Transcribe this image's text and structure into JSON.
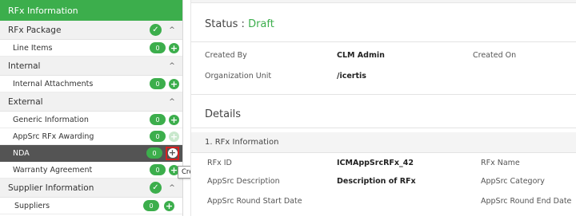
{
  "sidebar": {
    "header": "RFx Information",
    "sections": [
      {
        "label": "RFx Package",
        "items": [
          {
            "label": "Line Items",
            "count": "0"
          }
        ]
      },
      {
        "label": "Internal",
        "items": [
          {
            "label": "Internal Attachments",
            "count": "0"
          }
        ]
      },
      {
        "label": "External",
        "items": [
          {
            "label": "Generic Information",
            "count": "0"
          },
          {
            "label": "AppSrc RFx Awarding",
            "count": "0"
          },
          {
            "label": "NDA",
            "count": "0"
          },
          {
            "label": "Warranty Agreement",
            "count": "0"
          }
        ]
      },
      {
        "label": "Supplier Information",
        "items": [
          {
            "label": "Suppliers",
            "count": "0"
          }
        ]
      }
    ],
    "tooltip": "Create Association"
  },
  "main": {
    "status_label": "Status :",
    "status_value": "Draft",
    "fields": {
      "created_by_label": "Created By",
      "created_by_value": "CLM Admin",
      "created_on_label": "Created On",
      "org_unit_label": "Organization Unit",
      "org_unit_value": "/icertis"
    },
    "details_title": "Details",
    "section_title": "1. RFx Information",
    "rfx": {
      "rfx_id_label": "RFx ID",
      "rfx_id_value": "ICMAppSrcRFx_42",
      "rfx_name_label": "RFx Name",
      "desc_label": "AppSrc Description",
      "desc_value": "Description of RFx",
      "category_label": "AppSrc Category",
      "start_label": "AppSrc Round Start Date",
      "end_label": "AppSrc Round End Date"
    }
  },
  "colors": {
    "accent": "#3cae4c",
    "selected_row": "#545454",
    "highlight_border": "#d62020"
  }
}
